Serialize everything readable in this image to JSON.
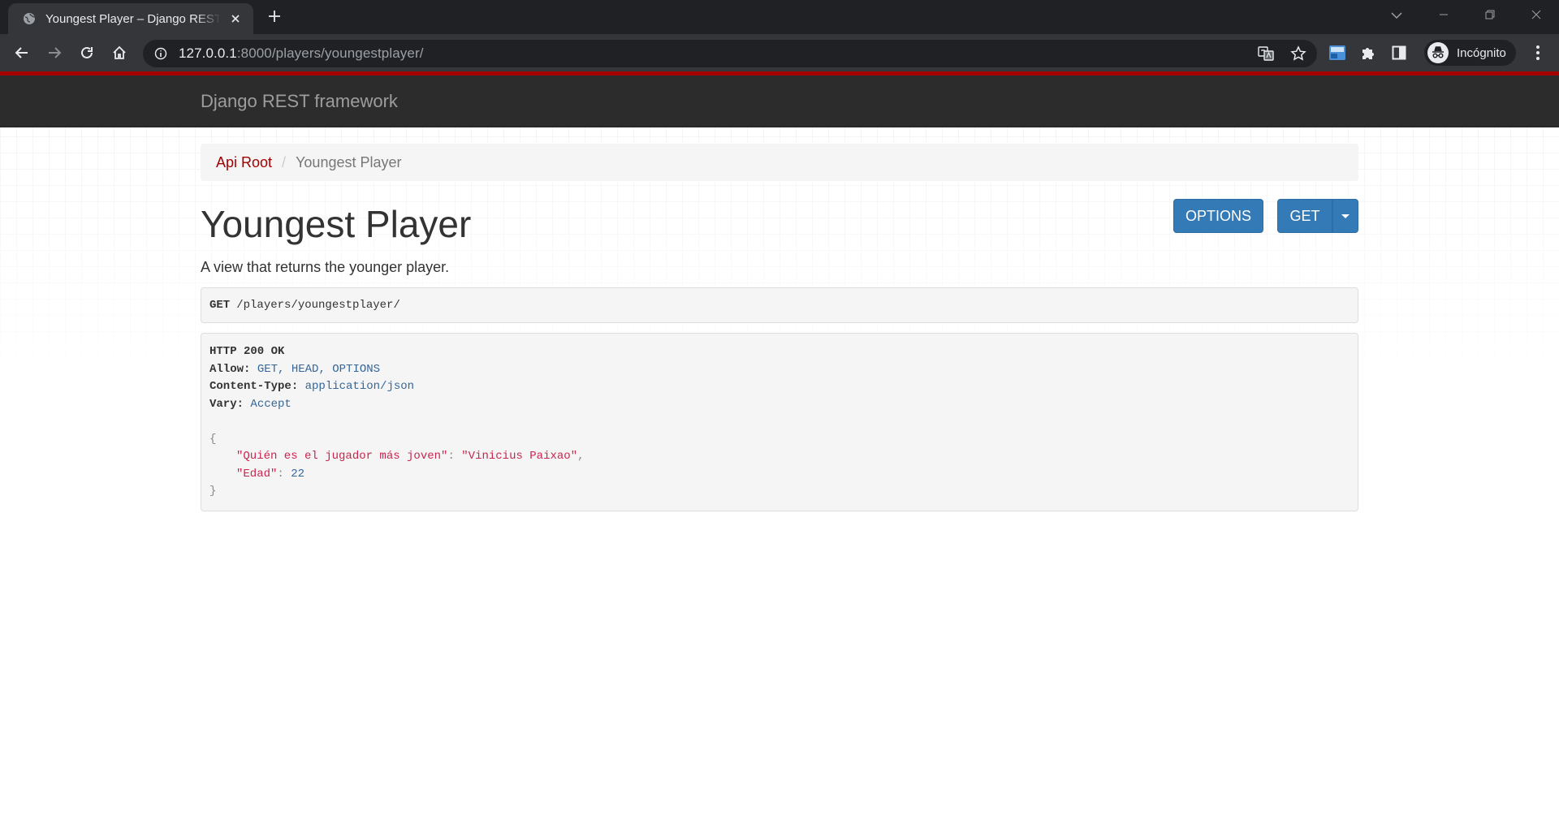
{
  "browser": {
    "tab_title": "Youngest Player – Django REST framework",
    "url_host": "127.0.0.1",
    "url_rest": ":8000/players/youngestplayer/",
    "profile_label": "Incógnito"
  },
  "navbar": {
    "brand": "Django REST framework"
  },
  "breadcrumb": {
    "root": "Api Root",
    "separator": "/",
    "current": "Youngest Player"
  },
  "page": {
    "title": "Youngest Player",
    "description": "A view that returns the younger player.",
    "options_button": "OPTIONS",
    "get_button": "GET"
  },
  "request": {
    "method": "GET",
    "path": "/players/youngestplayer/"
  },
  "response": {
    "status": "HTTP 200 OK",
    "headers": [
      {
        "name": "Allow:",
        "value": "GET, HEAD, OPTIONS"
      },
      {
        "name": "Content-Type:",
        "value": "application/json"
      },
      {
        "name": "Vary:",
        "value": "Accept"
      }
    ],
    "body_open": "{",
    "body_close": "}",
    "fields": [
      {
        "key": "\"Quién es el jugador más joven\"",
        "colon": ": ",
        "value": "\"Vinicius Paixao\"",
        "comma": ","
      },
      {
        "key": "\"Edad\"",
        "colon": ": ",
        "value": "22",
        "comma": ""
      }
    ]
  },
  "colors": {
    "accent_red": "#a30000",
    "button_blue": "#337ab7",
    "navbar_dark": "#2c2c2c"
  }
}
